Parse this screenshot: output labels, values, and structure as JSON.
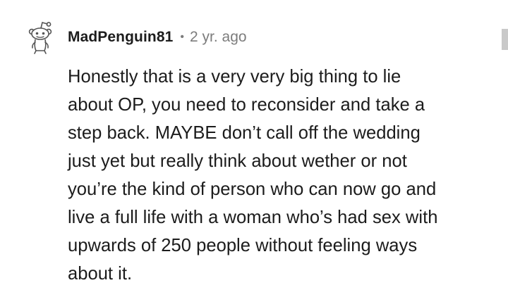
{
  "comment": {
    "username": "MadPenguin81",
    "separator": "•",
    "timestamp": "2 yr. ago",
    "avatar_icon": "snoo-avatar-icon",
    "body_lines": [
      "Honestly that is a very very big thing to lie",
      "about OP, you need to reconsider and take a",
      "step back. MAYBE don’t call off the wedding",
      "just yet but really think about wether or not",
      "you’re the kind of person who can now go and",
      "live a full life with a woman who’s had sex with",
      "upwards of 250 people without feeling ways",
      "about it."
    ]
  },
  "colors": {
    "text": "#1c1c1c",
    "meta": "#7c7c7c",
    "scrollbar": "#c9c9c9"
  }
}
